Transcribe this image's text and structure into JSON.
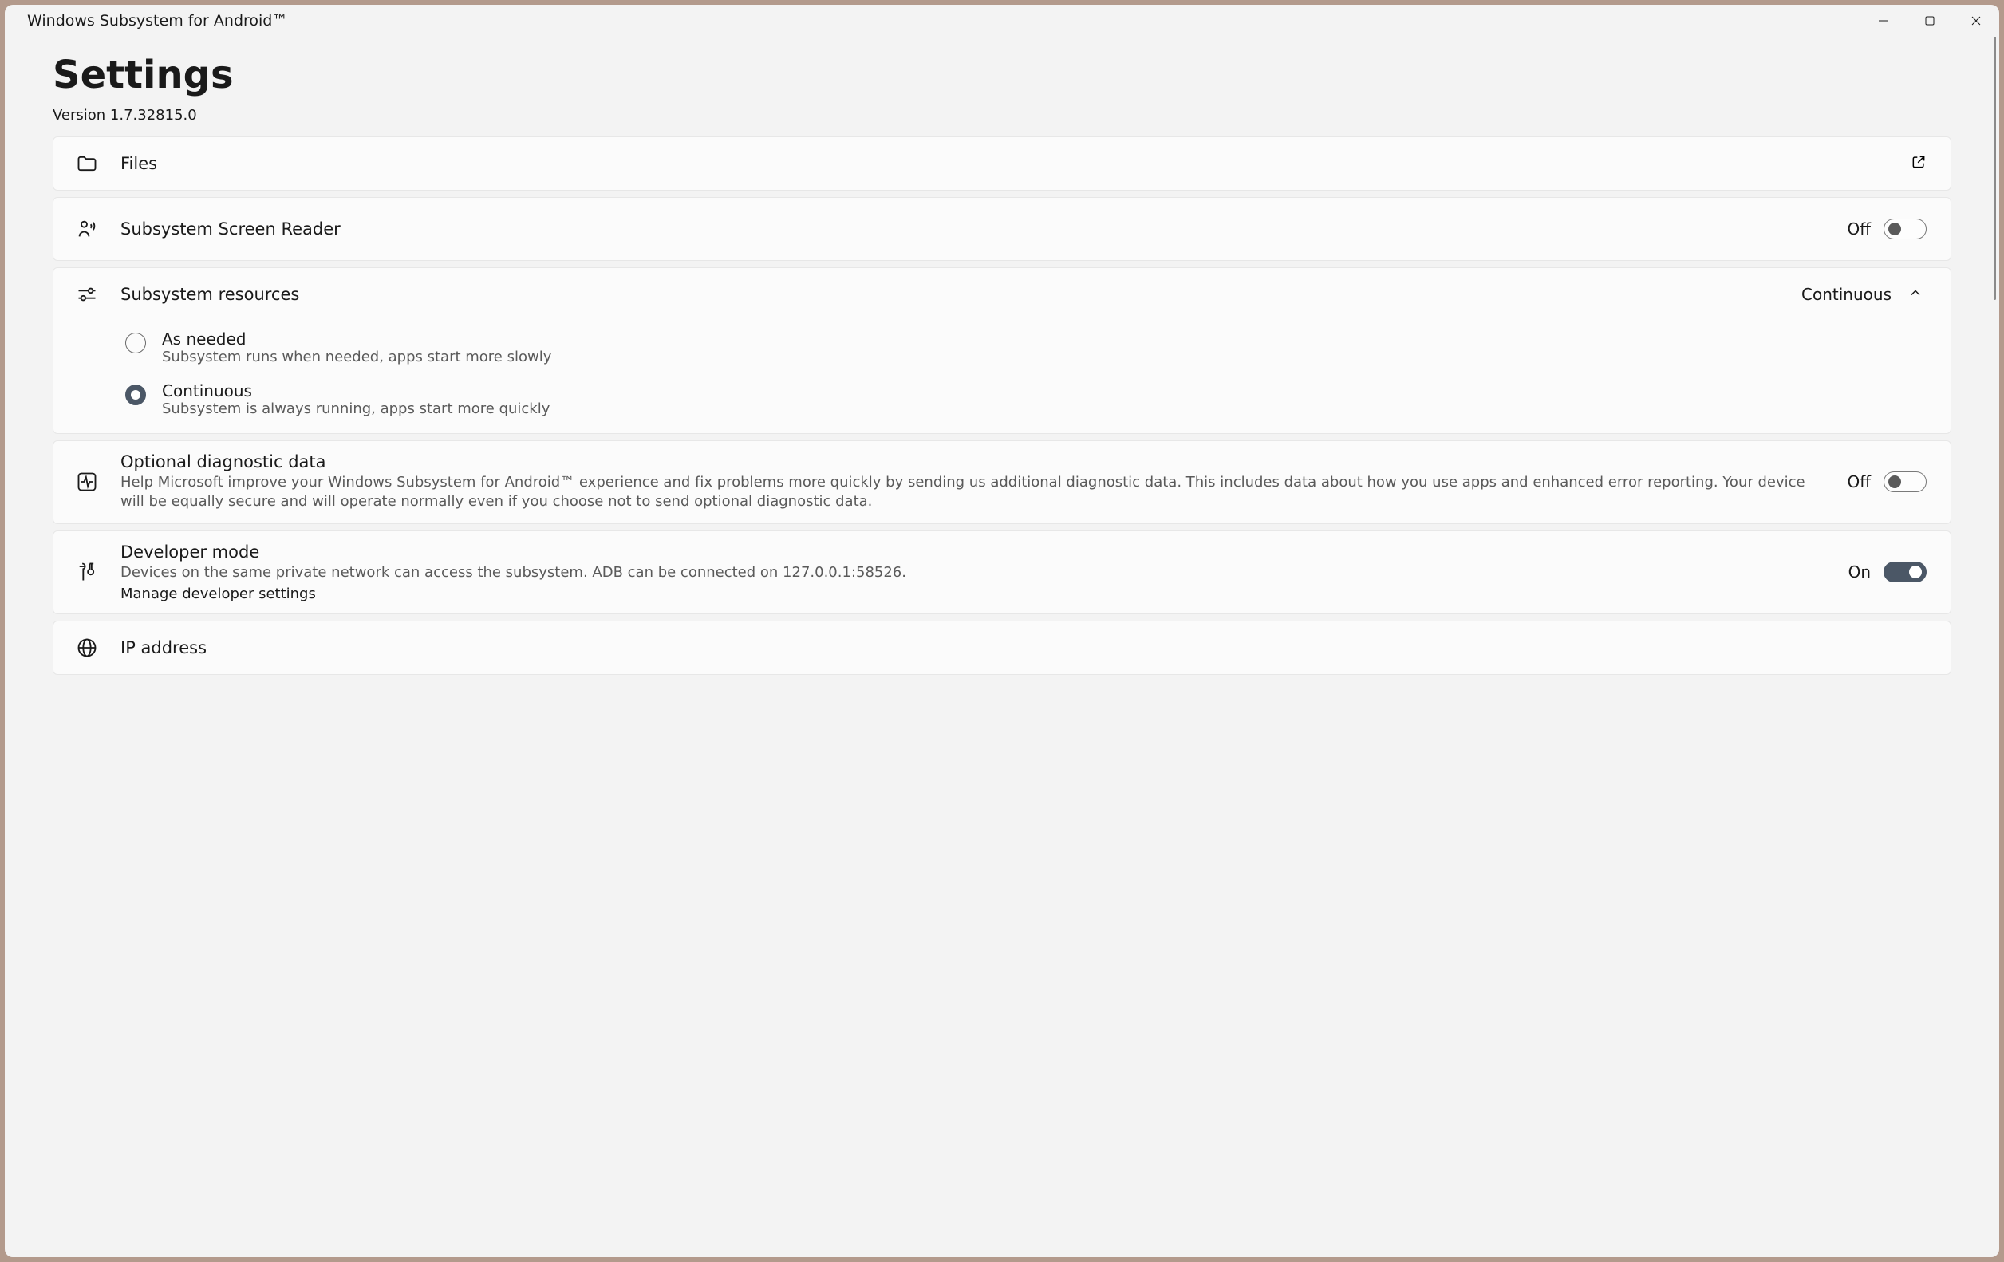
{
  "window": {
    "title": "Windows Subsystem for Android™"
  },
  "header": {
    "title": "Settings",
    "version": "Version 1.7.32815.0"
  },
  "cards": {
    "files": {
      "label": "Files"
    },
    "screenReader": {
      "label": "Subsystem Screen Reader",
      "state": "Off"
    },
    "resources": {
      "label": "Subsystem resources",
      "value": "Continuous",
      "options": [
        {
          "title": "As needed",
          "desc": "Subsystem runs when needed, apps start more slowly",
          "selected": false
        },
        {
          "title": "Continuous",
          "desc": "Subsystem is always running, apps start more quickly",
          "selected": true
        }
      ]
    },
    "diagnostics": {
      "title": "Optional diagnostic data",
      "desc": "Help Microsoft improve your Windows Subsystem for Android™ experience and fix problems more quickly by sending us additional diagnostic data. This includes data about how you use apps and enhanced error reporting. Your device will be equally secure and will operate normally even if you choose not to send optional diagnostic data.",
      "state": "Off"
    },
    "developer": {
      "title": "Developer mode",
      "desc": "Devices on the same private network can access the subsystem. ADB can be connected on 127.0.0.1:58526.",
      "link": "Manage developer settings",
      "state": "On"
    },
    "ip": {
      "title": "IP address"
    }
  }
}
